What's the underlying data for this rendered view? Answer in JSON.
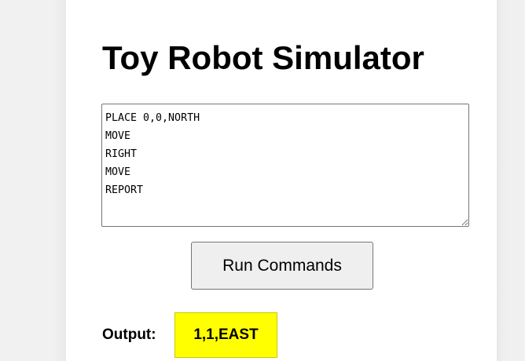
{
  "app": {
    "title": "Toy Robot Simulator"
  },
  "commands": {
    "value": "PLACE 0,0,NORTH\nMOVE\nRIGHT\nMOVE\nREPORT"
  },
  "run_button": {
    "label": "Run Commands"
  },
  "output": {
    "label": "Output:",
    "value": "1,1,EAST"
  },
  "colors": {
    "output_highlight": "#ffff00",
    "page_background": "#eeeeee",
    "card_background": "#ffffff"
  }
}
